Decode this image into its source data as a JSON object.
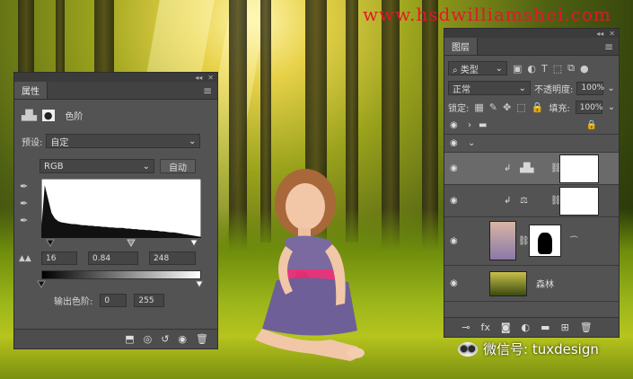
{
  "watermark": "www.hsdwilliamshei.com",
  "wechat_label": "微信号: tuxdesign",
  "properties": {
    "tab": "属性",
    "adjust_type": "色阶",
    "preset_label": "预设:",
    "preset_value": "自定",
    "channel": "RGB",
    "auto_button": "自动",
    "input_black": "16",
    "input_gamma": "0.84",
    "input_white": "248",
    "output_label": "输出色阶:",
    "output_black": "0",
    "output_white": "255",
    "histogram_levels": [
      0.15,
      0.95,
      0.7,
      0.45,
      0.35,
      0.3,
      0.28,
      0.27,
      0.26,
      0.25,
      0.25,
      0.24,
      0.23,
      0.23,
      0.22,
      0.22,
      0.21,
      0.21,
      0.2,
      0.2,
      0.19,
      0.19,
      0.18,
      0.18,
      0.18,
      0.17,
      0.17,
      0.16,
      0.16,
      0.15,
      0.15,
      0.14,
      0.14,
      0.13,
      0.13,
      0.12,
      0.12,
      0.11,
      0.1,
      0.1,
      0.09,
      0.08,
      0.07,
      0.06,
      0.05,
      0.04,
      0.03,
      0.02
    ]
  },
  "layers": {
    "tab": "图层",
    "filter_label": "类型",
    "blend_mode": "正常",
    "opacity_label": "不透明度:",
    "opacity_value": "100%",
    "lock_label": "锁定:",
    "fill_label": "填充:",
    "fill_value": "100%",
    "bg_layer_name": "森林"
  }
}
